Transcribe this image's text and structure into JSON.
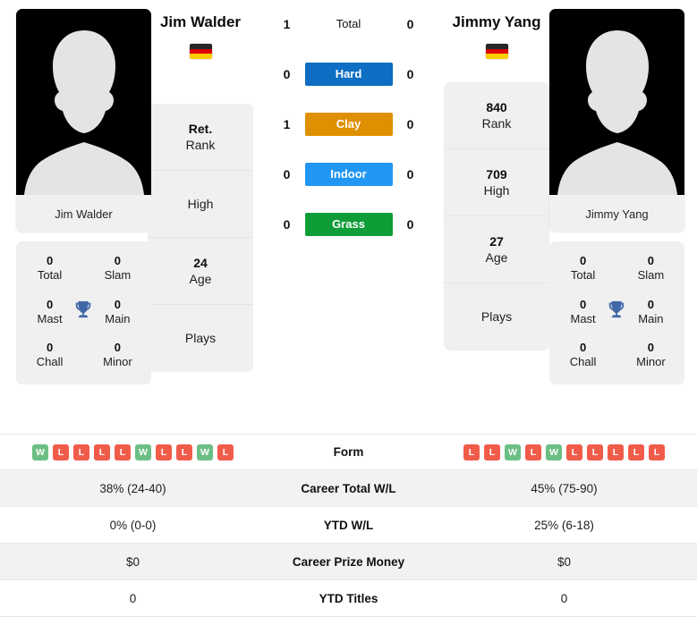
{
  "players": {
    "left": {
      "name": "Jim Walder",
      "photo_caption": "Jim Walder",
      "flag": "germany-flag",
      "titles": {
        "total_value": "0",
        "total_label": "Total",
        "slam_value": "0",
        "slam_label": "Slam",
        "mast_value": "0",
        "mast_label": "Mast",
        "main_value": "0",
        "main_label": "Main",
        "chall_value": "0",
        "chall_label": "Chall",
        "minor_value": "0",
        "minor_label": "Minor",
        "trophy_icon": "trophy-icon"
      },
      "info": {
        "rank_value": "Ret.",
        "rank_label": "Rank",
        "high_value": "",
        "high_label": "High",
        "age_value": "24",
        "age_label": "Age",
        "plays_value": "",
        "plays_label": "Plays"
      },
      "surface_counts": {
        "total": "1",
        "hard": "0",
        "clay": "1",
        "indoor": "0",
        "grass": "0"
      },
      "form": [
        "W",
        "L",
        "L",
        "L",
        "L",
        "W",
        "L",
        "L",
        "W",
        "L"
      ],
      "career_total_wl": "38% (24-40)",
      "ytd_wl": "0% (0-0)",
      "career_prize_money": "$0",
      "ytd_titles": "0"
    },
    "right": {
      "name": "Jimmy Yang",
      "photo_caption": "Jimmy Yang",
      "flag": "germany-flag",
      "titles": {
        "total_value": "0",
        "total_label": "Total",
        "slam_value": "0",
        "slam_label": "Slam",
        "mast_value": "0",
        "mast_label": "Mast",
        "main_value": "0",
        "main_label": "Main",
        "chall_value": "0",
        "chall_label": "Chall",
        "minor_value": "0",
        "minor_label": "Minor",
        "trophy_icon": "trophy-icon"
      },
      "info": {
        "rank_value": "840",
        "rank_label": "Rank",
        "high_value": "709",
        "high_label": "High",
        "age_value": "27",
        "age_label": "Age",
        "plays_value": "",
        "plays_label": "Plays"
      },
      "surface_counts": {
        "total": "0",
        "hard": "0",
        "clay": "0",
        "indoor": "0",
        "grass": "0"
      },
      "form": [
        "L",
        "L",
        "W",
        "L",
        "W",
        "L",
        "L",
        "L",
        "L",
        "L"
      ],
      "career_total_wl": "45% (75-90)",
      "ytd_wl": "25% (6-18)",
      "career_prize_money": "$0",
      "ytd_titles": "0"
    }
  },
  "surfaces": [
    {
      "key": "total",
      "label": "Total",
      "color": "transparent",
      "plain": true
    },
    {
      "key": "hard",
      "label": "Hard",
      "color": "#0d6ec3"
    },
    {
      "key": "clay",
      "label": "Clay",
      "color": "#de9000"
    },
    {
      "key": "indoor",
      "label": "Indoor",
      "color": "#2196f3"
    },
    {
      "key": "grass",
      "label": "Grass",
      "color": "#0f9d38"
    }
  ],
  "table_labels": {
    "form": "Form",
    "career_total_wl": "Career Total W/L",
    "ytd_wl": "YTD W/L",
    "career_prize_money": "Career Prize Money",
    "ytd_titles": "YTD Titles"
  },
  "colors": {
    "win_badge": "#6cbf84",
    "loss_badge": "#f05c4a",
    "card_bg": "#f0f0f0",
    "row_alt_bg": "#f2f2f2",
    "trophy": "#4068a8"
  }
}
